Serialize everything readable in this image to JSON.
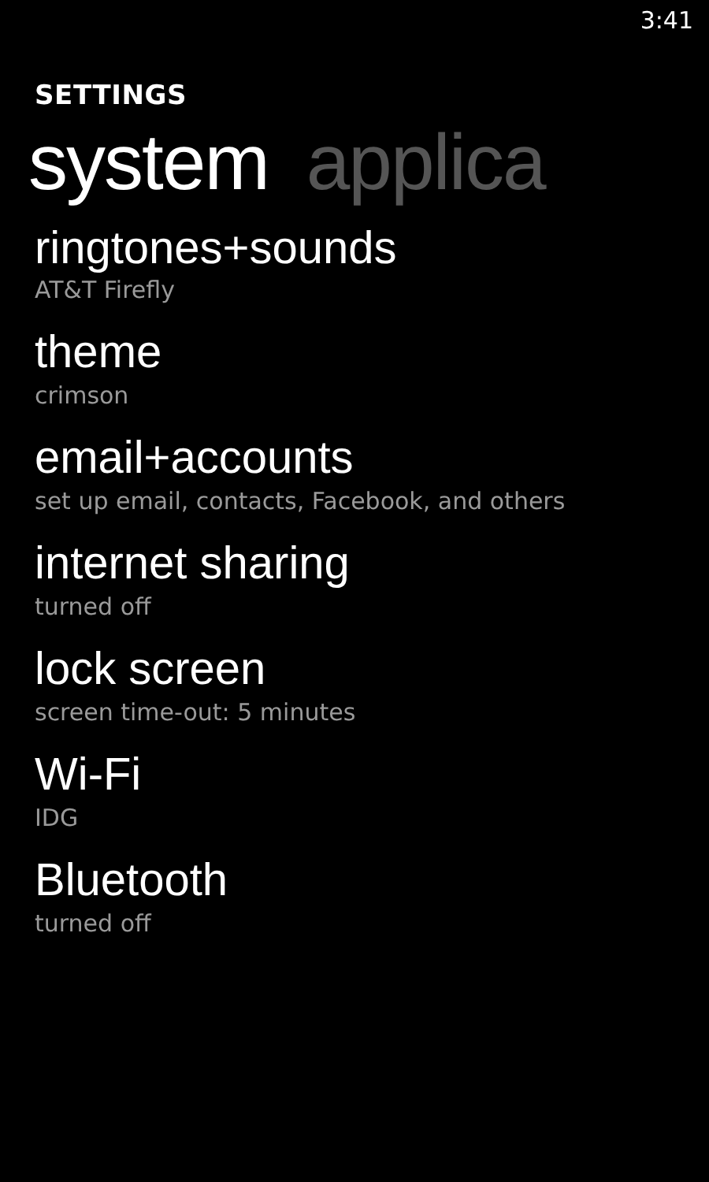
{
  "status_bar": {
    "time": "3:41"
  },
  "app_title": "SETTINGS",
  "pivots": [
    {
      "label": "system",
      "selected": true
    },
    {
      "label": "applica",
      "selected": false
    }
  ],
  "items": [
    {
      "title": "ringtones+sounds",
      "subtitle": "AT&T Firefly"
    },
    {
      "title": "theme",
      "subtitle": "crimson"
    },
    {
      "title": "email+accounts",
      "subtitle": "set up email, contacts, Facebook, and others"
    },
    {
      "title": "internet sharing",
      "subtitle": "turned off"
    },
    {
      "title": "lock screen",
      "subtitle": "screen time-out: 5 minutes"
    },
    {
      "title": "Wi-Fi",
      "subtitle": "IDG"
    },
    {
      "title": "Bluetooth",
      "subtitle": "turned off"
    }
  ]
}
